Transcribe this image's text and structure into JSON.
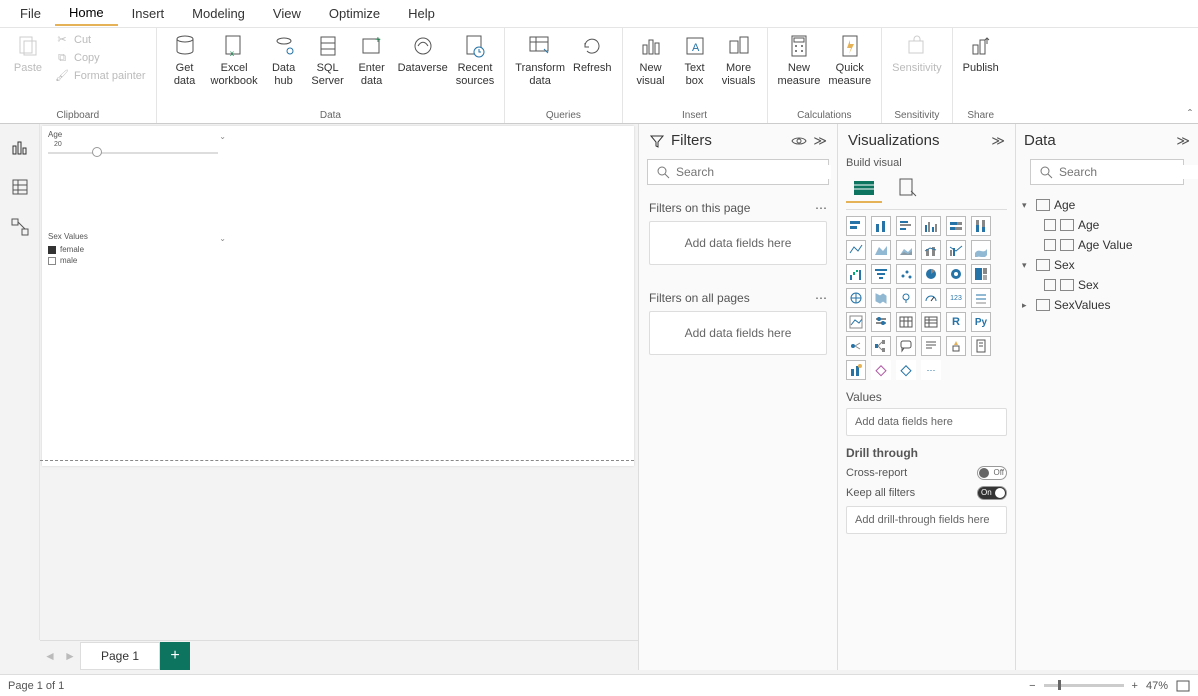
{
  "menu": {
    "items": [
      "File",
      "Home",
      "Insert",
      "Modeling",
      "View",
      "Optimize",
      "Help"
    ],
    "active": "Home"
  },
  "ribbon": {
    "clipboard": {
      "paste": "Paste",
      "cut": "Cut",
      "copy": "Copy",
      "format_painter": "Format painter",
      "label": "Clipboard"
    },
    "data": {
      "get_data": "Get\ndata",
      "excel": "Excel\nworkbook",
      "data_hub": "Data\nhub",
      "sql": "SQL\nServer",
      "enter": "Enter\ndata",
      "dataverse": "Dataverse",
      "recent": "Recent\nsources",
      "label": "Data"
    },
    "queries": {
      "transform": "Transform\ndata",
      "refresh": "Refresh",
      "label": "Queries"
    },
    "insert": {
      "new_visual": "New\nvisual",
      "text_box": "Text\nbox",
      "more": "More\nvisuals",
      "label": "Insert"
    },
    "calc": {
      "new_measure": "New\nmeasure",
      "quick": "Quick\nmeasure",
      "label": "Calculations"
    },
    "sensitivity": {
      "btn": "Sensitivity",
      "label": "Sensitivity"
    },
    "share": {
      "publish": "Publish",
      "label": "Share"
    }
  },
  "canvas": {
    "age": {
      "title": "Age",
      "value": "20"
    },
    "sex": {
      "title": "Sex Values",
      "female": "female",
      "male": "male"
    }
  },
  "page_tabs": {
    "page1": "Page 1"
  },
  "filters": {
    "title": "Filters",
    "search_placeholder": "Search",
    "on_page": "Filters on this page",
    "on_all": "Filters on all pages",
    "add": "Add data fields here"
  },
  "viz": {
    "title": "Visualizations",
    "build": "Build visual",
    "values": "Values",
    "add": "Add data fields here",
    "drill": "Drill through",
    "cross": "Cross-report",
    "keep": "Keep all filters",
    "off": "Off",
    "on": "On",
    "drill_add": "Add drill-through fields here"
  },
  "data_pane": {
    "title": "Data",
    "search_placeholder": "Search",
    "tables": {
      "age": {
        "label": "Age",
        "fields": [
          "Age",
          "Age Value"
        ]
      },
      "sex": {
        "label": "Sex",
        "fields": [
          "Sex"
        ]
      },
      "sexvalues": {
        "label": "SexValues"
      }
    }
  },
  "status": {
    "page": "Page 1 of 1",
    "zoom": "47%"
  }
}
